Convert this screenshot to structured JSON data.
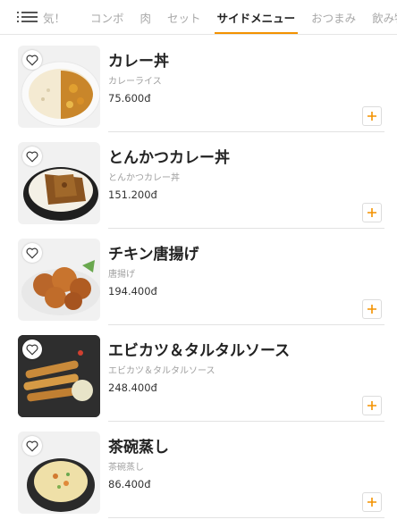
{
  "nav": {
    "partial_tab": "気！",
    "tabs": [
      "コンボ",
      "肉",
      "セット",
      "サイドメニュー",
      "おつまみ",
      "飲み物"
    ],
    "active_index": 3,
    "accent": "#f39200"
  },
  "items": [
    {
      "name": "カレー丼",
      "sub": "カレーライス",
      "price": "75.600đ",
      "icon": "curry-rice-photo"
    },
    {
      "name": "とんかつカレー丼",
      "sub": "とんかつカレー丼",
      "price": "151.200đ",
      "icon": "katsu-curry-photo"
    },
    {
      "name": "チキン唐揚げ",
      "sub": "唐揚げ",
      "price": "194.400đ",
      "icon": "karaage-photo"
    },
    {
      "name": "エビカツ＆タルタルソース",
      "sub": "エビカツ＆タルタルソース",
      "price": "248.400đ",
      "icon": "fried-shrimp-photo"
    },
    {
      "name": "茶碗蒸し",
      "sub": "茶碗蒸し",
      "price": "86.400đ",
      "icon": "chawanmushi-photo"
    }
  ]
}
